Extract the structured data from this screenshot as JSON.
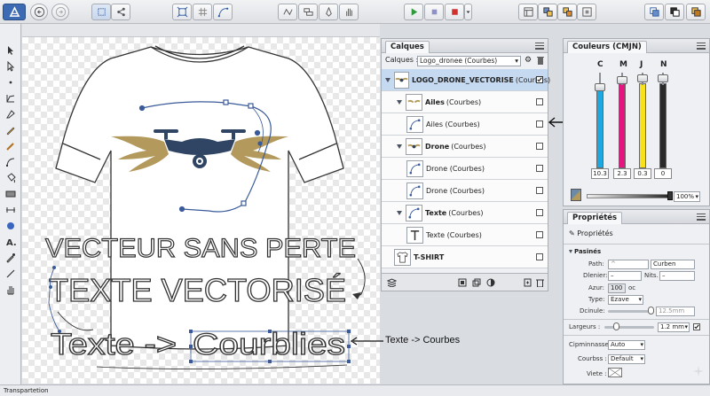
{
  "layers_panel": {
    "tab": "Calques",
    "selector_label": "Calques :",
    "selector_value": "Logo_dronee (Courbes)",
    "rows": [
      {
        "name": "LOGO_DRONE_VECTORISE",
        "type": "(Courbes)",
        "checked": true
      },
      {
        "name": "Ailes",
        "type": "(Courbes)",
        "checked": false
      },
      {
        "name": "Ailes (Courbes)",
        "type": "",
        "checked": false
      },
      {
        "name": "Drone",
        "type": "(Courbes)",
        "checked": false
      },
      {
        "name": "Drone (Courbes)",
        "type": "",
        "checked": false
      },
      {
        "name": "Drone (Courbes)",
        "type": "",
        "checked": false
      },
      {
        "name": "Texte",
        "type": "(Courbes)",
        "checked": false
      },
      {
        "name": "Texte (Courbes)",
        "type": "",
        "checked": false
      },
      {
        "name": "T-SHIRT",
        "type": "",
        "checked": false
      }
    ]
  },
  "color_panel": {
    "tab": "Couleurs (CMJN)",
    "channels": [
      {
        "letter": "C",
        "value": "10.3",
        "color": "#1ca9e0",
        "level": 0.103
      },
      {
        "letter": "M",
        "value": "2.3",
        "color": "#e4157f",
        "level": 0.023
      },
      {
        "letter": "J",
        "value": "0.3",
        "color": "#f7e11a",
        "level": 0.003
      },
      {
        "letter": "N",
        "value": "0",
        "color": "#2a2a2a",
        "level": 0.0
      }
    ],
    "opacity": "100%"
  },
  "props_panel": {
    "tab": "Propriétés",
    "title": "Propriétés",
    "section": "Pasinés",
    "path_label": "Path:",
    "path_value": "Curben",
    "dernier_label": "Dlenier:",
    "nits_label": "Nits.",
    "azur_label": "Azur:",
    "azur_value": "100",
    "azur_unit": "oc",
    "type_label": "Type:",
    "type_value": "Ezave",
    "dcinule_label": "Dcinule:",
    "dcinule_value": "12.5mm",
    "largeurs_label": "Largeurs :",
    "largeurs_value": "1.2 mm",
    "cpminnasse_label": "Cipminnasse :",
    "cpminnasse_value": "Auto",
    "courbes_label": "Courbss :",
    "courbes_value": "Default",
    "viete_label": "Viete :"
  },
  "canvas": {
    "text1": "VECTEUR SANS PERTE",
    "text2": "TEXTE VECTORISÉ",
    "text3_part1": "Texte ->",
    "text3_part2": "Courblies",
    "annotation": "Texte -> Courbes"
  },
  "status_text": "Transpartetion",
  "colors": {
    "wing_gold": "#b39a5c",
    "drone_navy": "#2f4563",
    "guide_blue": "#3a5a9a",
    "run_green": "#2e9a3a",
    "stop_red": "#d2322d"
  }
}
